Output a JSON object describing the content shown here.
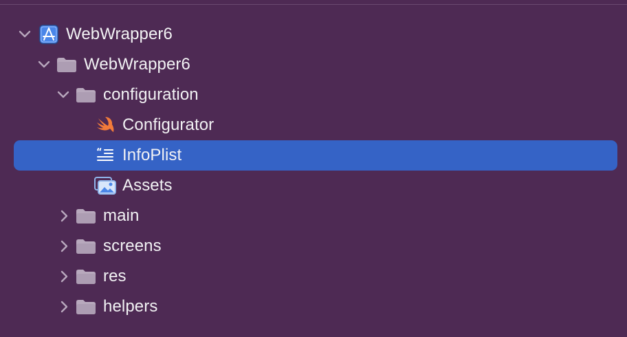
{
  "colors": {
    "background": "#4e2a54",
    "selection": "#3563c6",
    "text": "#f2f2f4",
    "folder": "#b8a9bd",
    "chevron": "#b9a8be",
    "swift": "#f27b3a",
    "project_icon": "#4a86e8"
  },
  "tree": [
    {
      "label": "WebWrapper6",
      "icon": "xcode-project-icon",
      "state": "expanded",
      "level": 0
    },
    {
      "label": "WebWrapper6",
      "icon": "folder-icon",
      "state": "expanded",
      "level": 1
    },
    {
      "label": "configuration",
      "icon": "folder-icon",
      "state": "expanded",
      "level": 2
    },
    {
      "label": "Configurator",
      "icon": "swift-file-icon",
      "state": "leaf",
      "level": 3
    },
    {
      "label": "InfoPlist",
      "icon": "plist-file-icon",
      "state": "leaf",
      "level": 3,
      "selected": true
    },
    {
      "label": "Assets",
      "icon": "asset-catalog-icon",
      "state": "leaf",
      "level": 3
    },
    {
      "label": "main",
      "icon": "folder-icon",
      "state": "collapsed",
      "level": 2
    },
    {
      "label": "screens",
      "icon": "folder-icon",
      "state": "collapsed",
      "level": 2
    },
    {
      "label": "res",
      "icon": "folder-icon",
      "state": "collapsed",
      "level": 2
    },
    {
      "label": "helpers",
      "icon": "folder-icon",
      "state": "collapsed",
      "level": 2
    }
  ]
}
